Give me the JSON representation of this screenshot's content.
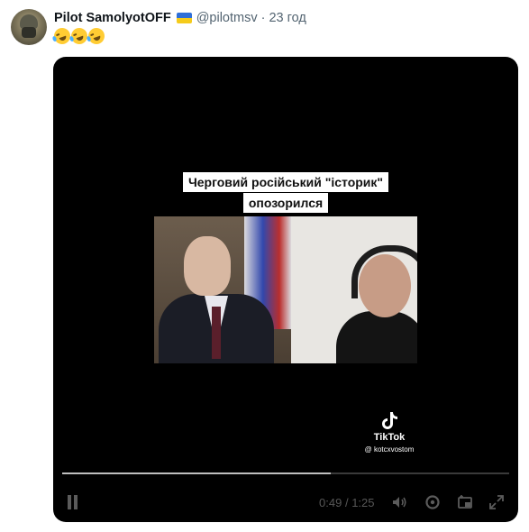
{
  "tweet": {
    "display_name": "Pilot SamolyotOFF",
    "handle": "@pilotmsv",
    "separator": "·",
    "time_ago": "23 год",
    "emoji": [
      "rolling-on-floor-laughing",
      "rolling-on-floor-laughing",
      "rolling-on-floor-laughing"
    ]
  },
  "video": {
    "caption_line1": "Черговий російський \"історик\"",
    "caption_line2": "опозорился",
    "watermark_name": "TikTok",
    "watermark_handle": "@ kotcxvostom",
    "current_time": "0:49",
    "time_sep": "/",
    "duration": "1:25",
    "progress_fraction": 0.6
  },
  "colors": {
    "player_bg": "#000000",
    "name_text": "#0f1419",
    "meta_text": "#536471",
    "flag_blue": "#2f6fd8",
    "flag_yellow": "#f5cb1b"
  },
  "icons": [
    "pause-icon",
    "volume-icon",
    "settings-icon",
    "picture-in-picture-icon",
    "fullscreen-icon"
  ]
}
